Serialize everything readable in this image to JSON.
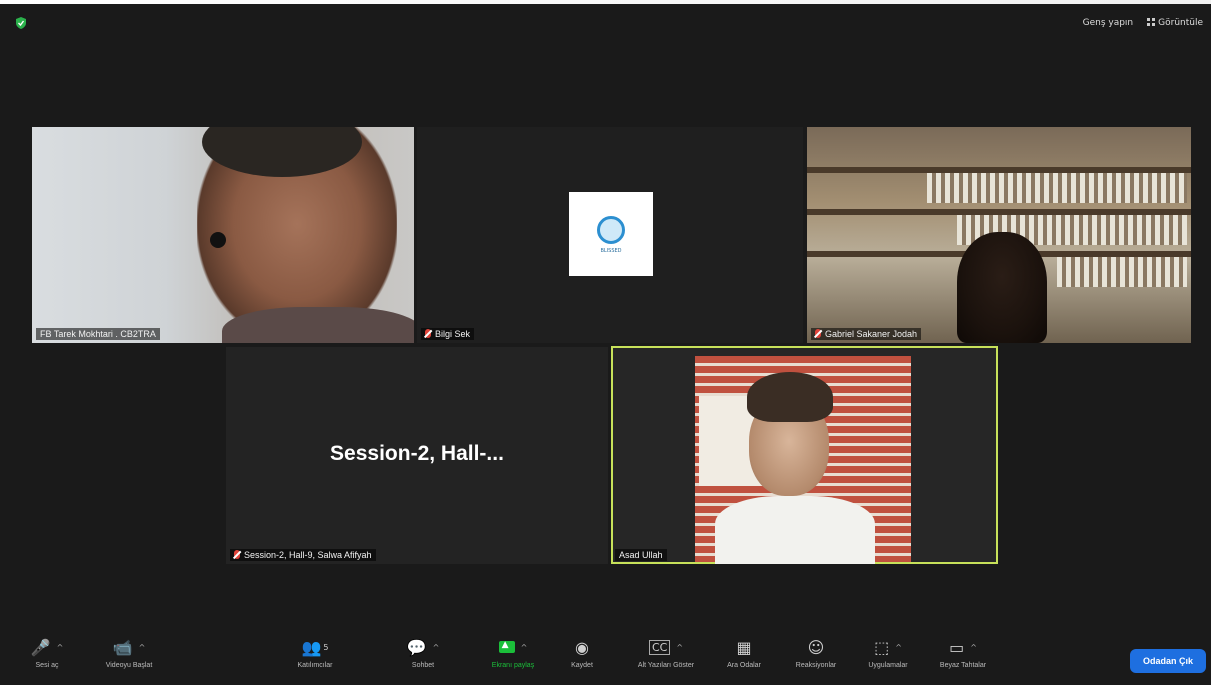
{
  "topbar": {
    "fullscreen_label": "Genş yapın",
    "view_label": "Görüntüle"
  },
  "tiles": [
    {
      "name": "FB Tarek Mokhtari . CB2TRA"
    },
    {
      "name": "Bilgi Sek"
    },
    {
      "name": "Gabriel Sakaner Jodah"
    },
    {
      "name": "Session-2, Hall-9, Salwa Afifyah",
      "title_text": "Session-2,  Hall-..."
    },
    {
      "name": "Asad Ullah"
    }
  ],
  "logo_text": "BLISSED",
  "toolbar": {
    "audio": "Sesi aç",
    "video": "Videoyu Başlat",
    "participants": "Katılımcılar",
    "participants_count": "5",
    "chat": "Sohbet",
    "share": "Ekranı paylaş",
    "record": "Kaydet",
    "captions": "Alt Yazıları Göster",
    "breakout": "Ara Odalar",
    "reactions": "Reaksiyonlar",
    "apps": "Uygulamalar",
    "whiteboard": "Beyaz Tahtalar",
    "leave": "Odadan Çık"
  },
  "colors": {
    "active_speaker_border": "#c7e15a",
    "share_green": "#1bbf3a",
    "leave_blue": "#1e6fe0",
    "mute_red": "#e0443a"
  }
}
